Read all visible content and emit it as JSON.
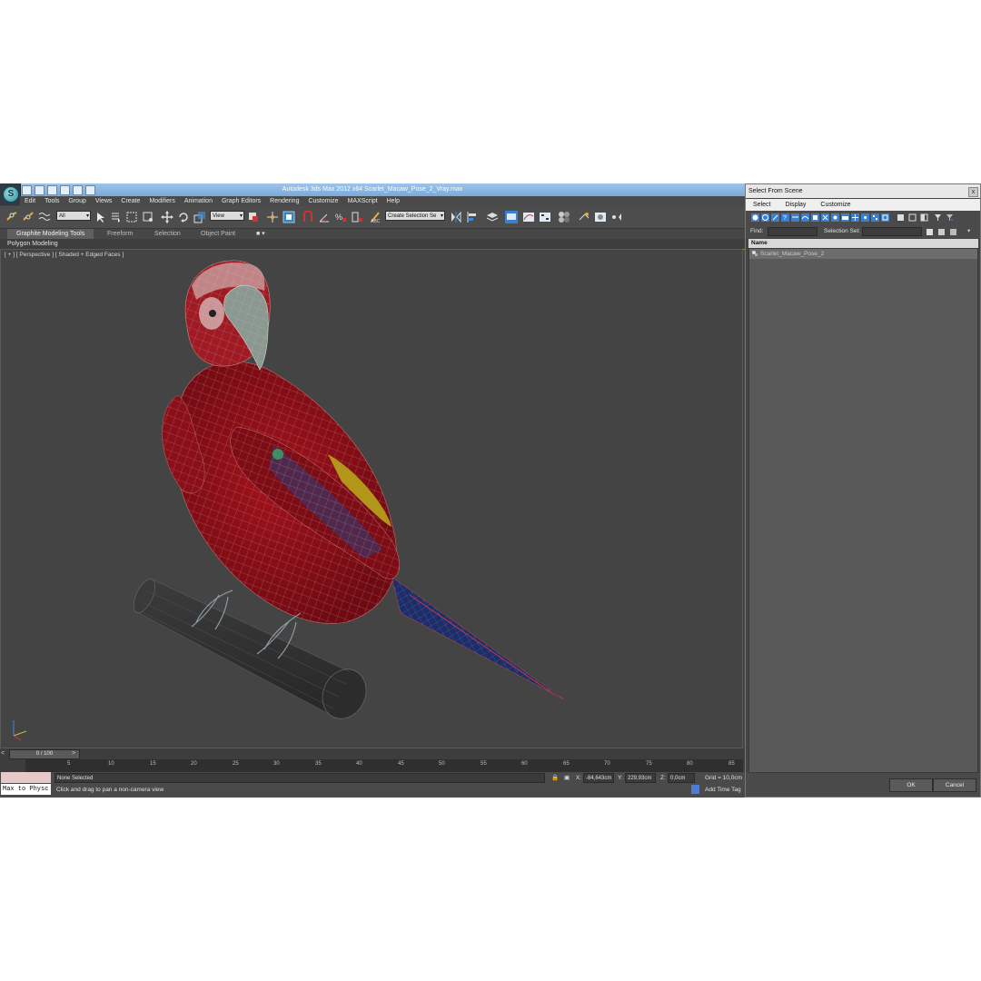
{
  "window": {
    "title": "Autodesk 3ds Max  2012 x64      Scarlet_Macaw_Pose_2_Vray.max"
  },
  "menu": [
    "Edit",
    "Tools",
    "Group",
    "Views",
    "Create",
    "Modifiers",
    "Animation",
    "Graph Editors",
    "Rendering",
    "Customize",
    "MAXScript",
    "Help"
  ],
  "toolbar": {
    "selection_filter": "All",
    "reference_coord": "View",
    "named_selection": "Create Selection Se",
    "snap_angle": "2.5"
  },
  "ribbon": {
    "tabs": [
      "Graphite Modeling Tools",
      "Freeform",
      "Selection",
      "Object Paint"
    ],
    "panel_label": "Polygon Modeling"
  },
  "viewport": {
    "label": "[ + ] [ Perspective ] [ Shaded + Edged Faces ]",
    "colors": {
      "background": "#444444",
      "macaw_red": "#8f0f17",
      "beak": "#8a9890",
      "perch": "#2a2a2a",
      "wing_blue": "#1c2d6a",
      "wing_yellow": "#b8a51a"
    }
  },
  "timeline": {
    "frame_display": "0 / 100",
    "prev_label": "<",
    "next_label": ">",
    "ticks": [
      "5",
      "10",
      "15",
      "20",
      "25",
      "30",
      "35",
      "40",
      "45",
      "50",
      "55",
      "60",
      "65",
      "70",
      "75",
      "80",
      "85"
    ]
  },
  "status": {
    "maxscript_text": "Max to Physc",
    "selection": "None Selected",
    "prompt": "Click and drag to pan a non-camera view",
    "x_label": "X:",
    "x_value": "-84,643cm",
    "y_label": "Y:",
    "y_value": "229,93cm",
    "z_label": "Z:",
    "z_value": "0,0cm",
    "grid": "Grid = 10,0cm",
    "add_time_tag": "Add Time Tag"
  },
  "dialog": {
    "title": "Select From Scene",
    "close": "x",
    "menu": [
      "Select",
      "Display",
      "Customize"
    ],
    "find_label": "Find:",
    "selection_set_label": "Selection Set:",
    "column_name": "Name",
    "objects": [
      "Scarlet_Macaw_Pose_2"
    ],
    "ok": "OK",
    "cancel": "Cancel"
  }
}
